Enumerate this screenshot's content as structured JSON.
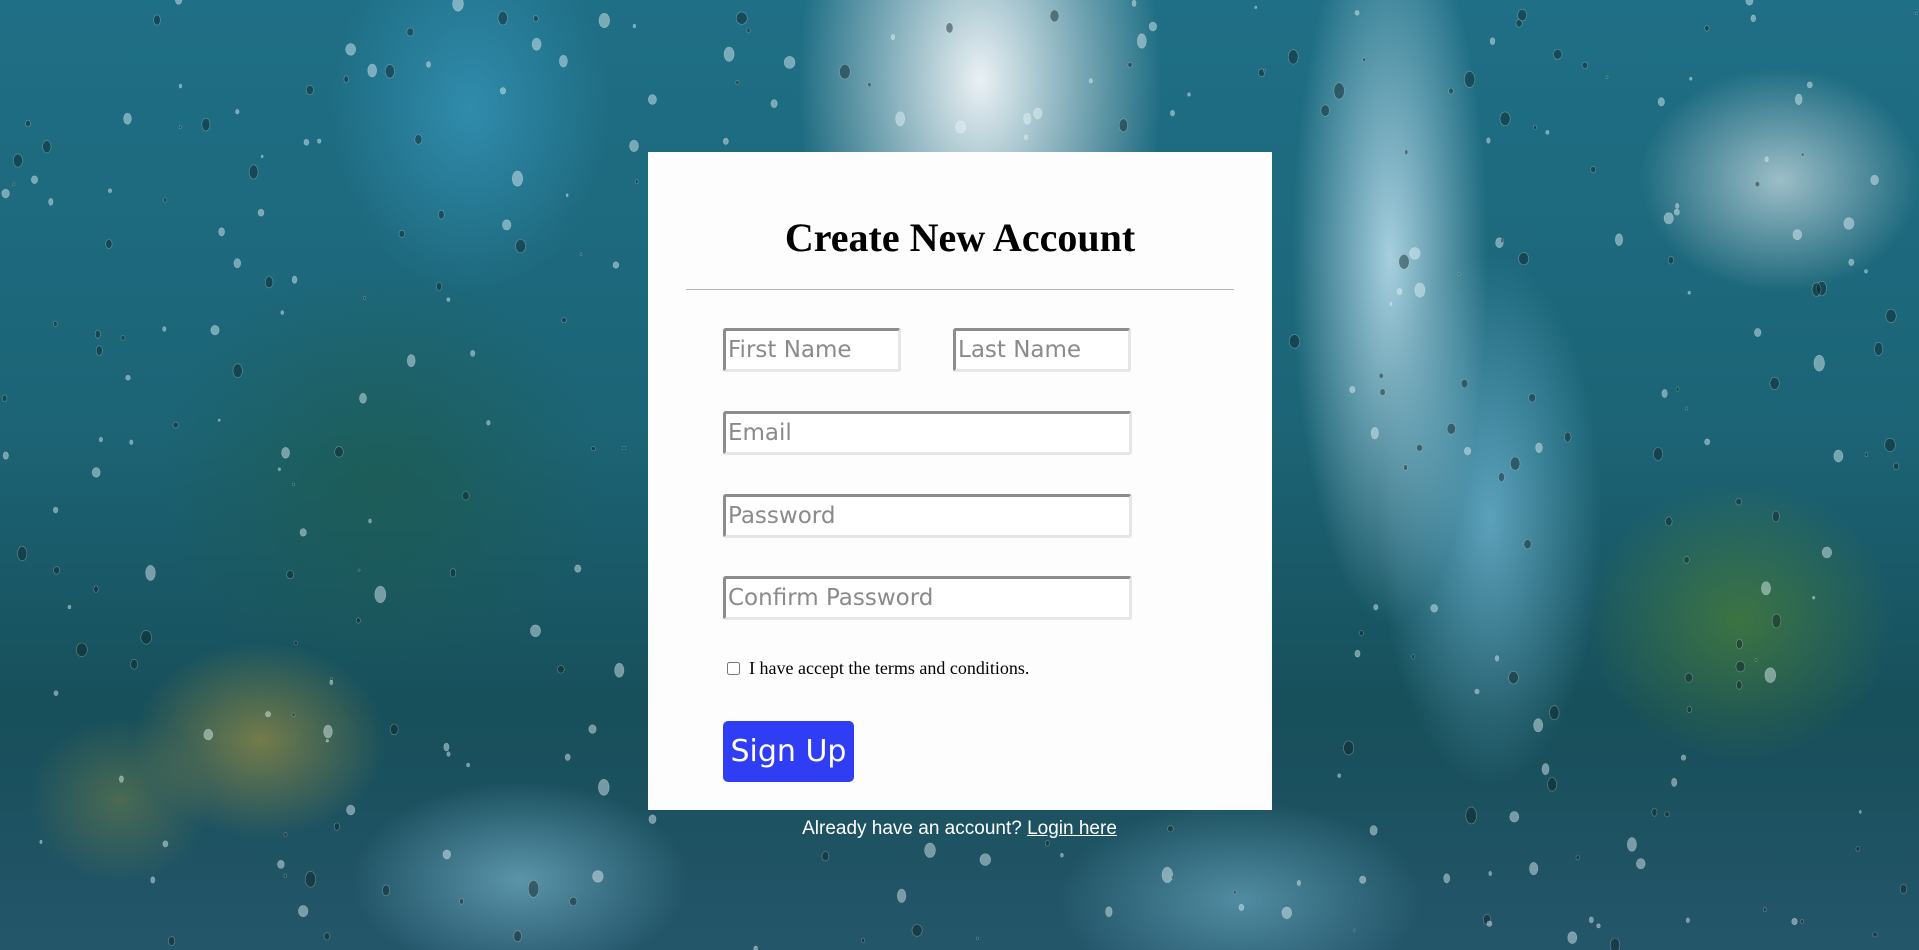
{
  "signup_form": {
    "title": "Create New Account",
    "fields": {
      "first_name": {
        "placeholder": "First Name",
        "value": ""
      },
      "last_name": {
        "placeholder": "Last Name",
        "value": ""
      },
      "email": {
        "placeholder": "Email",
        "value": ""
      },
      "password": {
        "placeholder": "Password",
        "value": ""
      },
      "confirm_password": {
        "placeholder": "Confirm Password",
        "value": ""
      }
    },
    "terms_label": "I have accept the terms and conditions.",
    "terms_checked": false,
    "submit_label": "Sign Up"
  },
  "login_prompt": {
    "text": "Already have an account?",
    "link_label": "Login here"
  },
  "colors": {
    "button_bg": "#2f3df5",
    "card_bg": "#fdfdfd",
    "background": "#1c6476"
  }
}
